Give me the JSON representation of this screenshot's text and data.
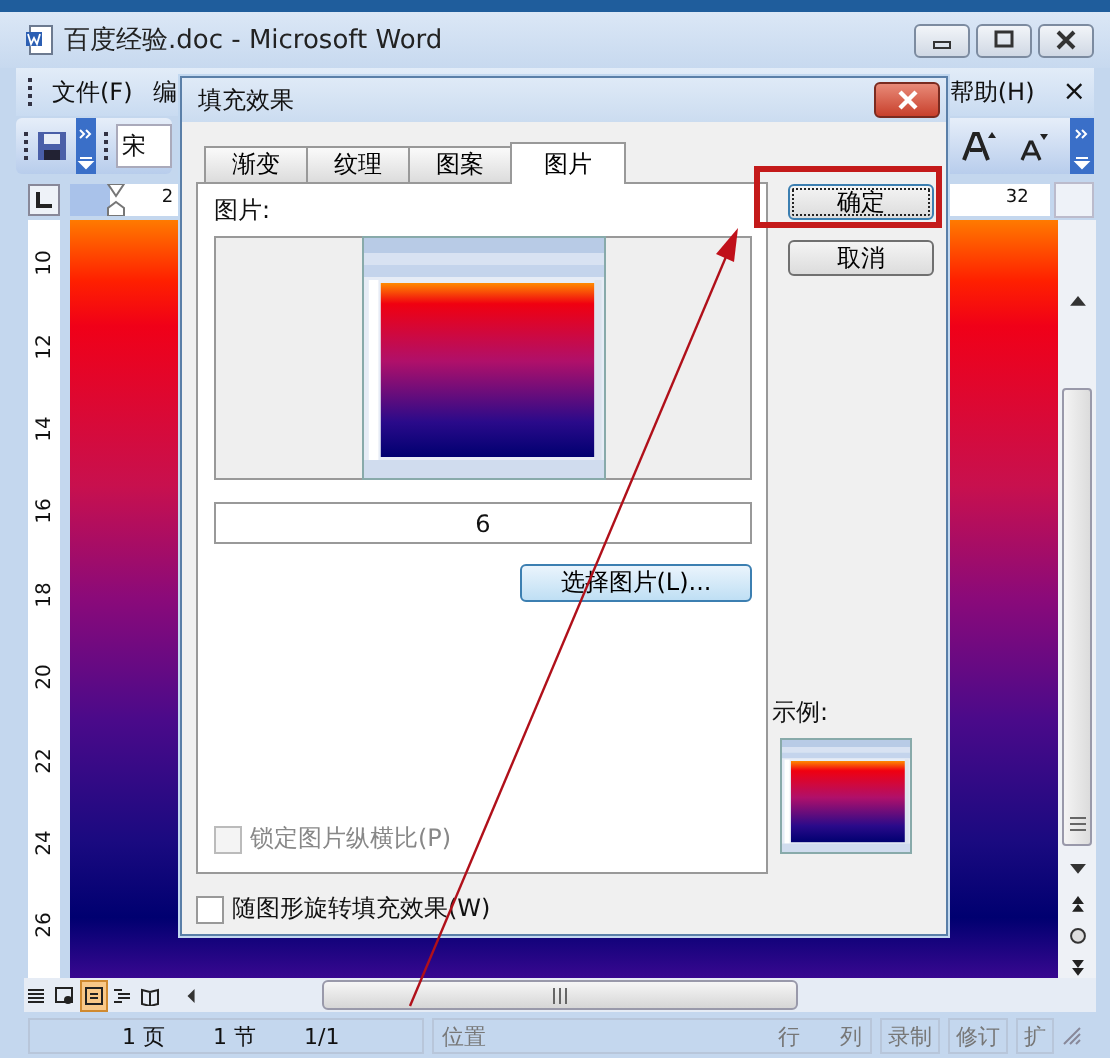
{
  "window": {
    "title": "百度经验.doc - Microsoft Word"
  },
  "menu": {
    "items": [
      {
        "label": "文件(F)"
      },
      {
        "label": "编"
      },
      {
        "label": "帮助(H)"
      }
    ],
    "close": "×"
  },
  "toolbar": {
    "font": "宋"
  },
  "ruler": {
    "marks": [
      "2",
      "32"
    ]
  },
  "vertical_ruler": [
    "10",
    "12",
    "14",
    "16",
    "18",
    "20",
    "22",
    "24",
    "26"
  ],
  "view_buttons": [
    {
      "selected": false
    },
    {
      "selected": false
    },
    {
      "selected": true
    },
    {
      "selected": false
    },
    {
      "selected": false
    }
  ],
  "status_bar": {
    "page_info": [
      "1 页",
      "1 节",
      "1/1"
    ],
    "position": {
      "label": "位置",
      "row": "行",
      "column": "列"
    },
    "modes": [
      {
        "label": "录制",
        "disabled": true
      },
      {
        "label": "修订",
        "disabled": true
      },
      {
        "label": "扩",
        "disabled": true
      }
    ]
  },
  "dialog": {
    "title": "填充效果",
    "tabs": [
      {
        "label": "渐变",
        "selected": false
      },
      {
        "label": "纹理",
        "selected": false
      },
      {
        "label": "图案",
        "selected": false
      },
      {
        "label": "图片",
        "selected": true
      }
    ],
    "picture_label": "图片:",
    "picture_name": "6",
    "select_button": "选择图片(L)...",
    "lock_aspect": {
      "label": "锁定图片纵横比(P)",
      "checked": false,
      "disabled": true
    },
    "rotate_with_shape": {
      "label": "随图形旋转填充效果(W)",
      "checked": false,
      "disabled": false
    },
    "buttons": [
      {
        "label": "确定",
        "highlighted": true
      },
      {
        "label": "取消",
        "highlighted": false
      }
    ],
    "sample_label": "示例:"
  }
}
